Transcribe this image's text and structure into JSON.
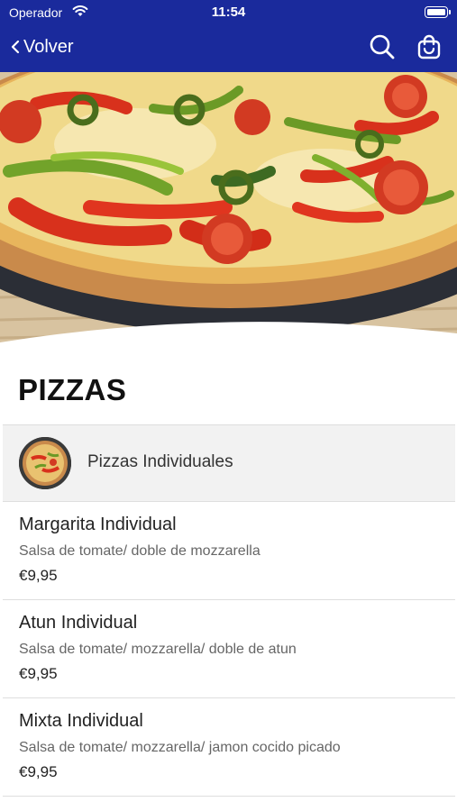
{
  "status_bar": {
    "carrier": "Operador",
    "time": "11:54"
  },
  "nav": {
    "back_label": "Volver",
    "icons": [
      "search-icon",
      "shopping-bag-icon"
    ],
    "background_color": "#1a2a9c"
  },
  "hero": {
    "image": "pizza-photo"
  },
  "section": {
    "title": "PIZZAS"
  },
  "category": {
    "label": "Pizzas Individuales"
  },
  "items": [
    {
      "name": "Margarita Individual",
      "description": "Salsa de tomate/ doble de mozzarella",
      "price": "€9,95"
    },
    {
      "name": "Atun Individual",
      "description": "Salsa de tomate/ mozzarella/ doble de atun",
      "price": "€9,95"
    },
    {
      "name": "Mixta Individual",
      "description": "Salsa de tomate/ mozzarella/ jamon cocido picado",
      "price": "€9,95"
    }
  ]
}
